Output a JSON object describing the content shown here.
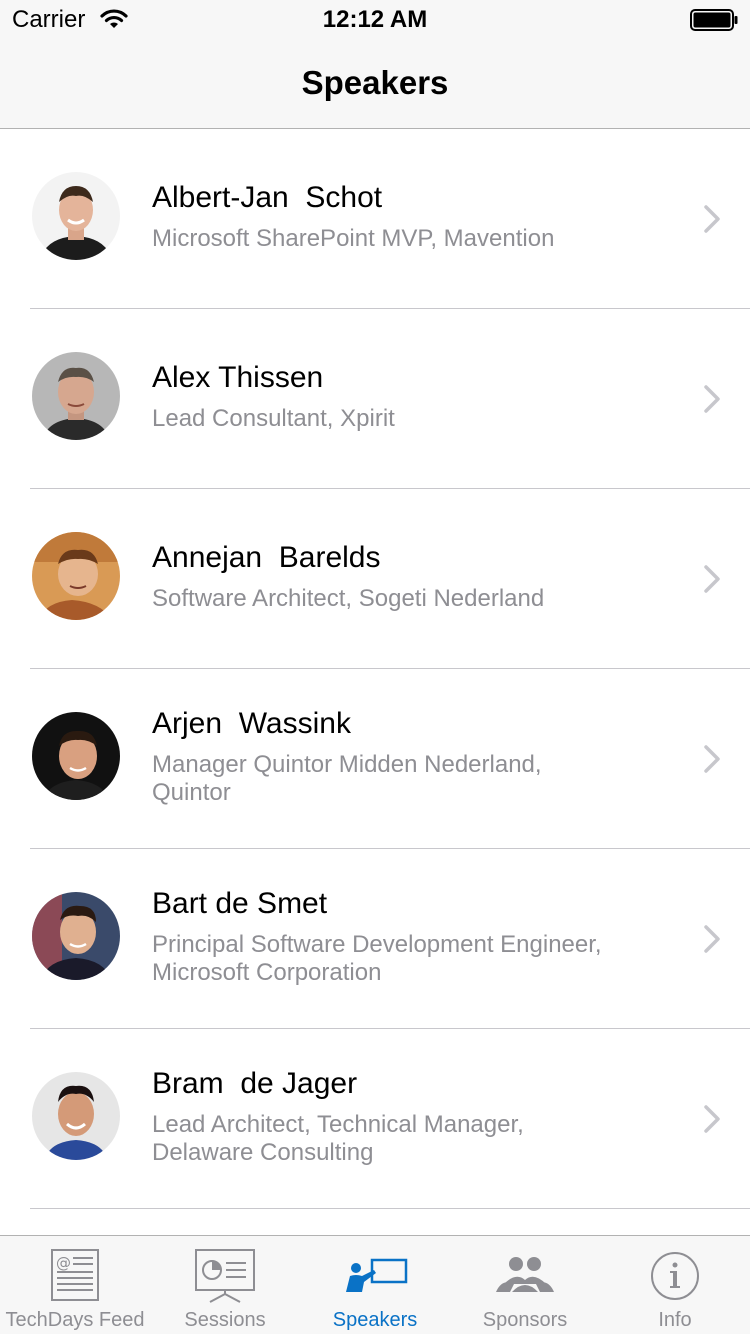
{
  "status_bar": {
    "carrier": "Carrier",
    "time": "12:12 AM"
  },
  "nav": {
    "title": "Speakers"
  },
  "speakers": [
    {
      "name": "Albert-Jan  Schot",
      "title_lines": [
        "Microsoft SharePoint MVP, Mavention"
      ],
      "avatar_icon": "person-photo"
    },
    {
      "name": "Alex Thissen",
      "title_lines": [
        "Lead Consultant, Xpirit"
      ],
      "avatar_icon": "person-photo"
    },
    {
      "name": "Annejan  Barelds",
      "title_lines": [
        "Software Architect, Sogeti Nederland"
      ],
      "avatar_icon": "person-photo"
    },
    {
      "name": "Arjen  Wassink",
      "title_lines": [
        "Manager Quintor Midden Nederland,",
        "Quintor"
      ],
      "avatar_icon": "person-photo"
    },
    {
      "name": "Bart de Smet",
      "title_lines": [
        "Principal Software Development Engineer,",
        "Microsoft Corporation"
      ],
      "avatar_icon": "person-photo"
    },
    {
      "name": "Bram  de Jager",
      "title_lines": [
        "Lead Architect, Technical Manager,",
        "Delaware Consulting"
      ],
      "avatar_icon": "person-photo"
    }
  ],
  "tabs": [
    {
      "label": "TechDays Feed",
      "icon": "newspaper-icon",
      "active": false
    },
    {
      "label": "Sessions",
      "icon": "presentation-icon",
      "active": false
    },
    {
      "label": "Speakers",
      "icon": "speaker-icon",
      "active": true
    },
    {
      "label": "Sponsors",
      "icon": "people-group-icon",
      "active": false
    },
    {
      "label": "Info",
      "icon": "info-icon",
      "active": false
    }
  ],
  "colors": {
    "accent": "#0a72c6",
    "inactive": "#8e8e93",
    "bar_background": "#f7f7f7"
  }
}
